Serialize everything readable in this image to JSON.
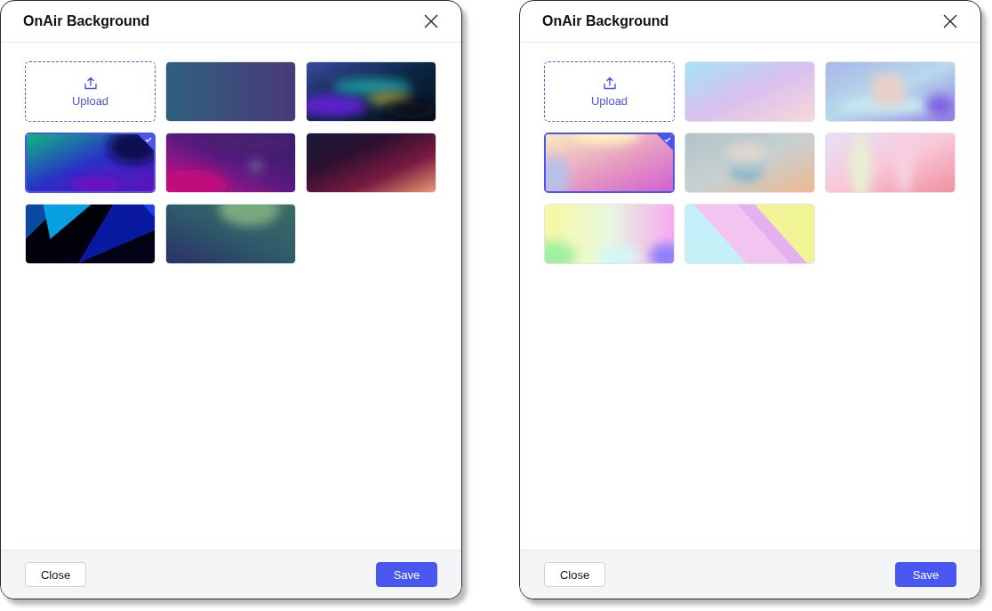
{
  "dialogs": [
    {
      "title": "OnAir Background",
      "tiles": [
        {
          "kind": "upload",
          "label": "Upload",
          "selected": false
        },
        {
          "kind": "picture",
          "selected": false
        },
        {
          "kind": "picture",
          "selected": false
        },
        {
          "kind": "picture",
          "selected": true
        },
        {
          "kind": "picture",
          "selected": false
        },
        {
          "kind": "picture",
          "selected": false
        },
        {
          "kind": "picture",
          "selected": false
        },
        {
          "kind": "picture",
          "selected": false
        }
      ],
      "buttons": [
        {
          "label": "Close",
          "kind": "secondary"
        },
        {
          "label": "Save",
          "kind": "primary"
        }
      ]
    },
    {
      "title": "OnAir Background",
      "tiles": [
        {
          "kind": "upload",
          "label": "Upload",
          "selected": false
        },
        {
          "kind": "picture",
          "selected": false
        },
        {
          "kind": "picture",
          "selected": false
        },
        {
          "kind": "picture",
          "selected": true
        },
        {
          "kind": "picture",
          "selected": false
        },
        {
          "kind": "picture",
          "selected": false
        },
        {
          "kind": "picture",
          "selected": false
        },
        {
          "kind": "picture",
          "selected": false
        }
      ],
      "buttons": [
        {
          "label": "Close",
          "kind": "secondary"
        },
        {
          "label": "Save",
          "kind": "primary"
        }
      ]
    }
  ]
}
